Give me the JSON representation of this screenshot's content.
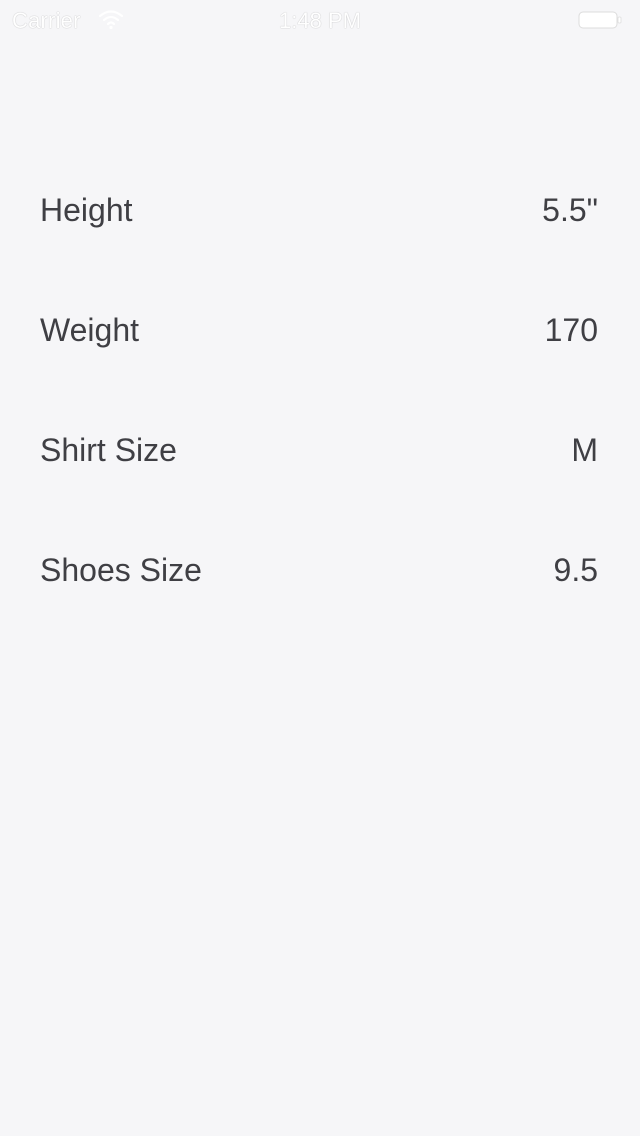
{
  "status_bar": {
    "carrier": "Carrier",
    "time": "1:48 PM",
    "wifi_icon": "wifi-icon",
    "battery_icon": "battery-icon"
  },
  "colors": {
    "background": "#f6f6f8",
    "text": "#3f3f44",
    "status_text": "#ffffff"
  },
  "rows": [
    {
      "label": "Height",
      "value": "5.5\""
    },
    {
      "label": "Weight",
      "value": "170"
    },
    {
      "label": "Shirt Size",
      "value": "M"
    },
    {
      "label": "Shoes Size",
      "value": "9.5"
    }
  ]
}
